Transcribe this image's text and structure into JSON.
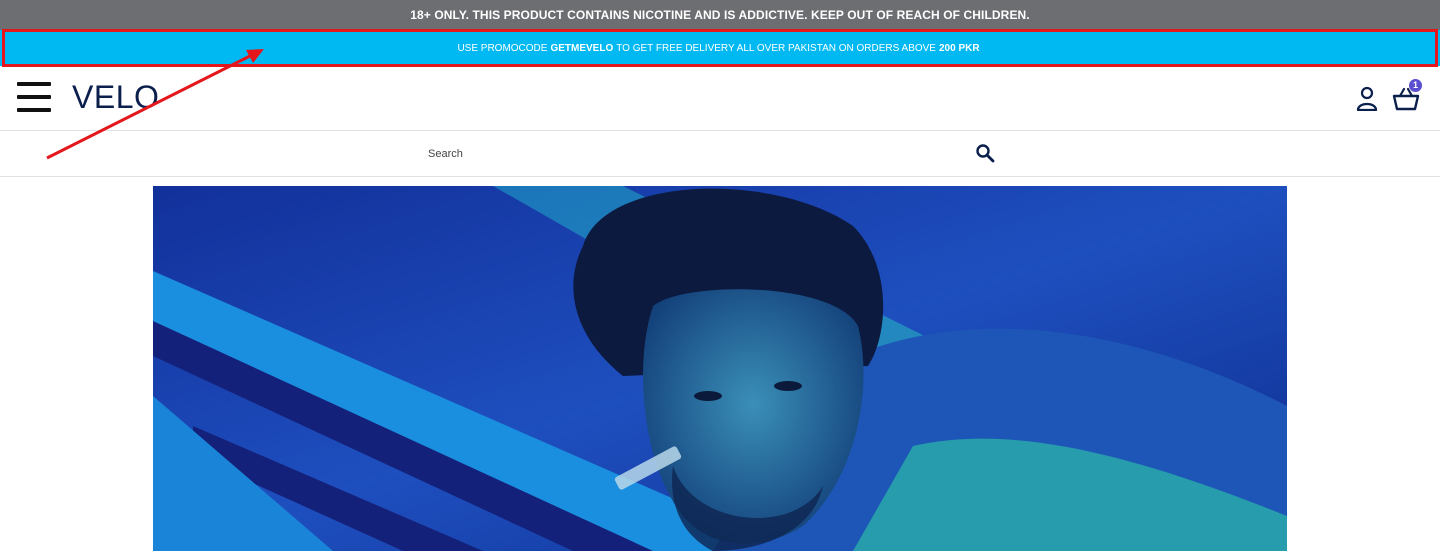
{
  "warning": {
    "text": "18+ ONLY. THIS PRODUCT CONTAINS NICOTINE AND IS ADDICTIVE. KEEP OUT OF REACH OF CHILDREN."
  },
  "promo": {
    "prefix": "USE PROMOCODE",
    "code": "GETMEVELO",
    "middle": "TO GET FREE DELIVERY ALL OVER PAKISTAN ON ORDERS ABOVE",
    "amount": "200 PKR"
  },
  "header": {
    "logo": "VELO",
    "cart_count": "1"
  },
  "search": {
    "placeholder": "Search"
  },
  "colors": {
    "warning_bg": "#6d6e71",
    "promo_bg": "#00b9f2",
    "logo": "#0b1f4d",
    "annotation": "#e3171c",
    "badge": "#5b4fd0"
  },
  "icons": [
    "menu-icon",
    "user-icon",
    "basket-icon",
    "search-icon"
  ]
}
